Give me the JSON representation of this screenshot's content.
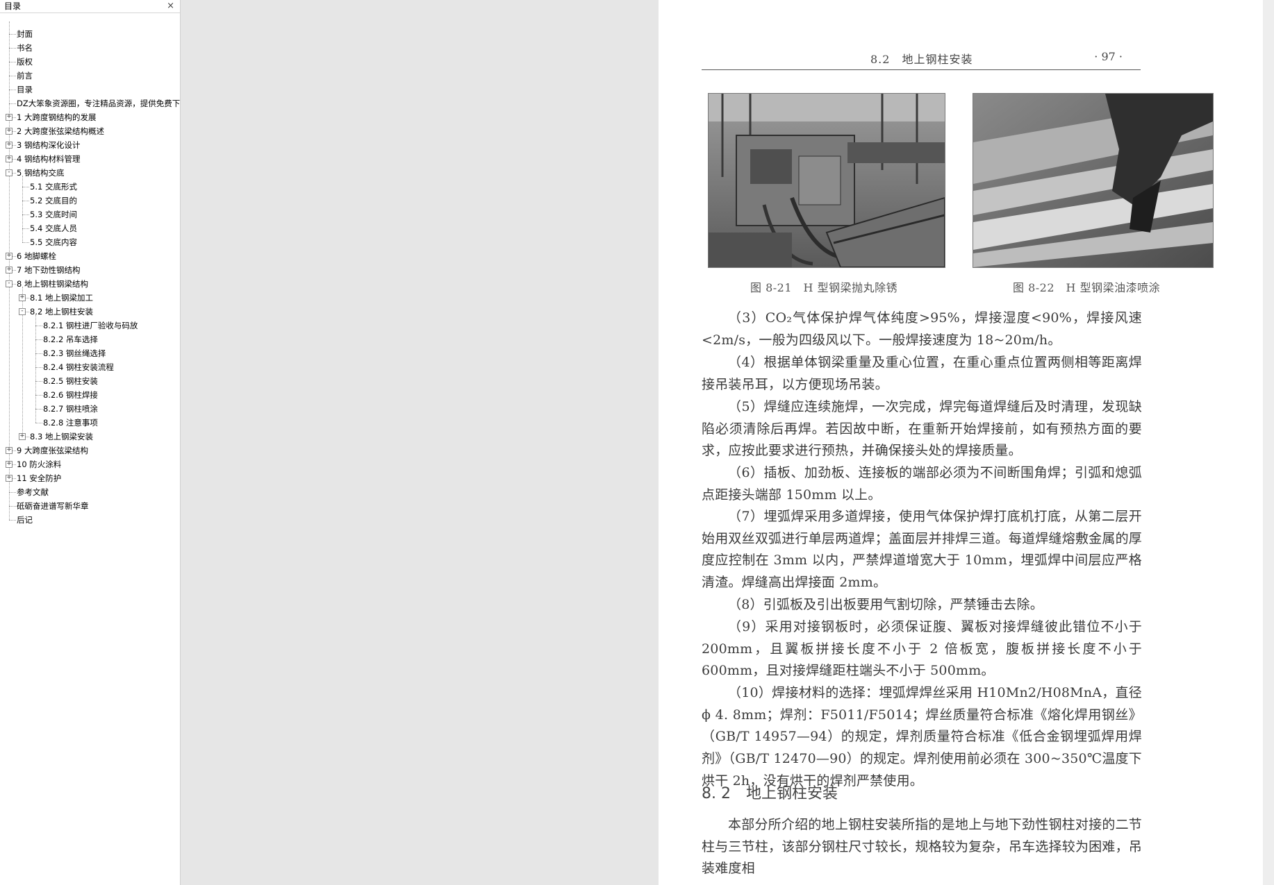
{
  "toc": {
    "title": "目录",
    "close_glyph": "×",
    "items": [
      {
        "label": "封面",
        "level": 0,
        "expander": ""
      },
      {
        "label": "书名",
        "level": 0,
        "expander": ""
      },
      {
        "label": "版权",
        "level": 0,
        "expander": ""
      },
      {
        "label": "前言",
        "level": 0,
        "expander": ""
      },
      {
        "label": "目录",
        "level": 0,
        "expander": ""
      },
      {
        "label": "DZ大笨象资源圈，专注精品资源，提供免费下",
        "level": 0,
        "expander": ""
      },
      {
        "label": "1 大跨度钢结构的发展",
        "level": 0,
        "expander": "+"
      },
      {
        "label": "2 大跨度张弦梁结构概述",
        "level": 0,
        "expander": "+"
      },
      {
        "label": "3 钢结构深化设计",
        "level": 0,
        "expander": "+"
      },
      {
        "label": "4 钢结构材料管理",
        "level": 0,
        "expander": "+"
      },
      {
        "label": "5 钢结构交底",
        "level": 0,
        "expander": "-"
      },
      {
        "label": "5.1 交底形式",
        "level": 1,
        "expander": ""
      },
      {
        "label": "5.2 交底目的",
        "level": 1,
        "expander": ""
      },
      {
        "label": "5.3 交底时间",
        "level": 1,
        "expander": ""
      },
      {
        "label": "5.4 交底人员",
        "level": 1,
        "expander": ""
      },
      {
        "label": "5.5 交底内容",
        "level": 1,
        "expander": ""
      },
      {
        "label": "6 地脚螺栓",
        "level": 0,
        "expander": "+"
      },
      {
        "label": "7 地下劲性钢结构",
        "level": 0,
        "expander": "+"
      },
      {
        "label": "8 地上钢柱钢梁结构",
        "level": 0,
        "expander": "-"
      },
      {
        "label": "8.1 地上钢梁加工",
        "level": 1,
        "expander": "+"
      },
      {
        "label": "8.2 地上钢柱安装",
        "level": 1,
        "expander": "-"
      },
      {
        "label": "8.2.1 钢柱进厂验收与码放",
        "level": 2,
        "expander": ""
      },
      {
        "label": "8.2.2 吊车选择",
        "level": 2,
        "expander": ""
      },
      {
        "label": "8.2.3 钢丝绳选择",
        "level": 2,
        "expander": ""
      },
      {
        "label": "8.2.4 钢柱安装流程",
        "level": 2,
        "expander": ""
      },
      {
        "label": "8.2.5 钢柱安装",
        "level": 2,
        "expander": ""
      },
      {
        "label": "8.2.6 钢柱焊接",
        "level": 2,
        "expander": ""
      },
      {
        "label": "8.2.7 钢柱喷涂",
        "level": 2,
        "expander": ""
      },
      {
        "label": "8.2.8 注意事项",
        "level": 2,
        "expander": ""
      },
      {
        "label": "8.3 地上钢梁安装",
        "level": 1,
        "expander": "+"
      },
      {
        "label": "9 大跨度张弦梁结构",
        "level": 0,
        "expander": "+"
      },
      {
        "label": "10 防火涂料",
        "level": 0,
        "expander": "+"
      },
      {
        "label": "11 安全防护",
        "level": 0,
        "expander": "+"
      },
      {
        "label": "参考文献",
        "level": 0,
        "expander": ""
      },
      {
        "label": "砥砺奋进谱写新华章",
        "level": 0,
        "expander": ""
      },
      {
        "label": "后记",
        "level": 0,
        "expander": ""
      }
    ]
  },
  "page": {
    "running_title": "8.2　地上钢柱安装",
    "page_number": "· 97 ·",
    "figures": [
      {
        "caption": "图 8-21　H 型钢梁抛丸除锈"
      },
      {
        "caption": "图 8-22　H 型钢梁油漆喷涂"
      }
    ],
    "paragraphs": [
      "（3）CO₂气体保护焊气体纯度>95%，焊接湿度<90%，焊接风速<2m/s，一般为四级风以下。一般焊接速度为 18~20m/h。",
      "（4）根据单体钢梁重量及重心位置，在重心重点位置两侧相等距离焊接吊装吊耳，以方便现场吊装。",
      "（5）焊缝应连续施焊，一次完成，焊完每道焊缝后及时清理，发现缺陷必须清除后再焊。若因故中断，在重新开始焊接前，如有预热方面的要求，应按此要求进行预热，并确保接头处的焊接质量。",
      "（6）插板、加劲板、连接板的端部必须为不间断围角焊；引弧和熄弧点距接头端部 150mm 以上。",
      "（7）埋弧焊采用多道焊接，使用气体保护焊打底机打底，从第二层开始用双丝双弧进行单层两道焊；盖面层并排焊三道。每道焊缝熔敷金属的厚度应控制在 3mm 以内，严禁焊道增宽大于 10mm，埋弧焊中间层应严格清渣。焊缝高出焊接面 2mm。",
      "（8）引弧板及引出板要用气割切除，严禁锤击去除。",
      "（9）采用对接钢板时，必须保证腹、翼板对接焊缝彼此错位不小于 200mm，且翼板拼接长度不小于 2 倍板宽，腹板拼接长度不小于 600mm，且对接焊缝距柱端头不小于 500mm。",
      "（10）焊接材料的选择：埋弧焊焊丝采用 H10Mn2/H08MnA，直径 ϕ 4. 8mm；焊剂：F5011/F5014；焊丝质量符合标准《熔化焊用钢丝》（GB/T 14957—94）的规定，焊剂质量符合标准《低合金钢埋弧焊用焊剂》（GB/T 12470—90）的规定。焊剂使用前必须在 300~350℃温度下烘干 2h，没有烘干的焊剂严禁使用。"
    ],
    "section_heading": "8. 2　地上钢柱安装",
    "section_paragraph": "本部分所介绍的地上钢柱安装所指的是地上与地下劲性钢柱对接的二节柱与三节柱，该部分钢柱尺寸较长，规格较为复杂，吊车选择较为困难，吊装难度相"
  }
}
